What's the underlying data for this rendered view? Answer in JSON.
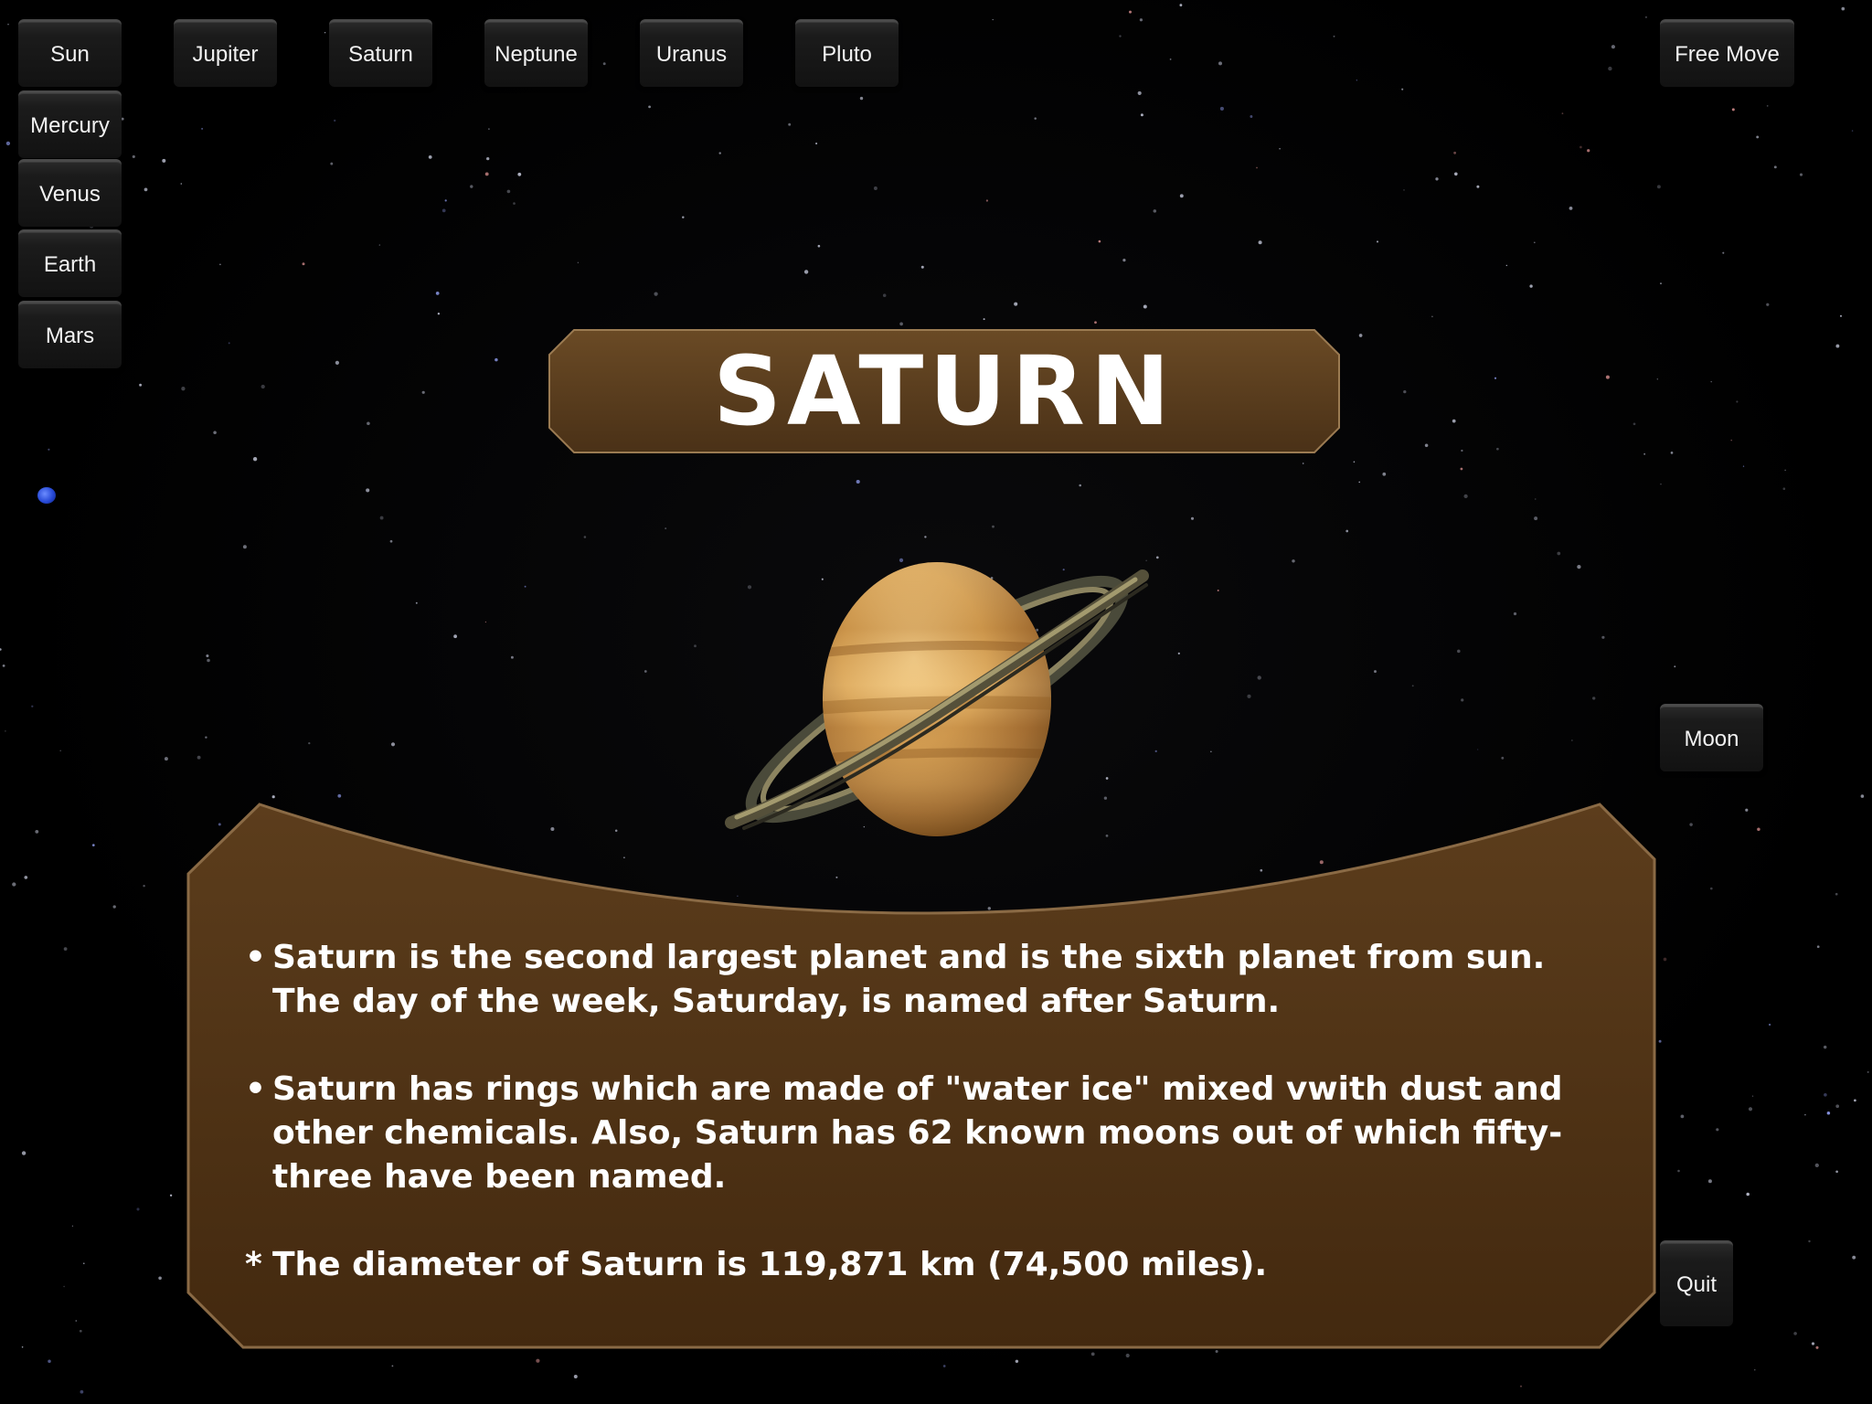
{
  "nav": {
    "sun": "Sun",
    "mercury": "Mercury",
    "venus": "Venus",
    "earth": "Earth",
    "mars": "Mars",
    "jupiter": "Jupiter",
    "saturn": "Saturn",
    "neptune": "Neptune",
    "uranus": "Uranus",
    "pluto": "Pluto",
    "free_move": "Free Move",
    "moon": "Moon",
    "quit": "Quit"
  },
  "title": "SATURN",
  "info": {
    "bullet1": "Saturn is the second largest planet and is the sixth planet from sun. The day of the week, Saturday, is named after Saturn.",
    "bullet2": "Saturn has rings which are made of \"water ice\" mixed vwith dust and other chemicals. Also, Saturn has 62 known moons out of which fifty-three have been named.",
    "bullet1_mark": "•",
    "bullet2_mark": "•",
    "note_mark": "*",
    "note": "The diameter of Saturn is 119,871 km (74,500 miles)."
  },
  "colors": {
    "panel_brown": "#4f3517",
    "panel_border": "#8a6a45",
    "button_bg": "#1b1b1b",
    "button_text": "#f2f2f2"
  }
}
